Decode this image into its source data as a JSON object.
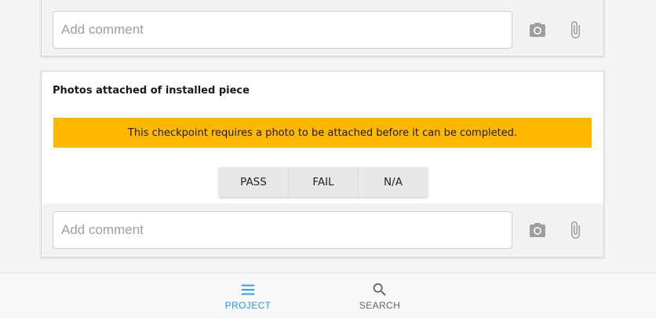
{
  "colors": {
    "warning_bg": "#ffb800",
    "accent": "#2196f3",
    "icon_gray": "#9e9e9e"
  },
  "top_card": {
    "comment_placeholder": "Add comment",
    "camera_icon": "camera-icon",
    "attach_icon": "paperclip-icon"
  },
  "checkpoint": {
    "title": "Photos attached of installed piece",
    "warning": "This checkpoint requires a photo to be attached before it can be completed.",
    "options": [
      "PASS",
      "FAIL",
      "N/A"
    ],
    "comment_placeholder": "Add comment",
    "camera_icon": "camera-icon",
    "attach_icon": "paperclip-icon"
  },
  "bottom_nav": {
    "items": [
      {
        "label": "PROJECT",
        "icon": "menu-icon",
        "active": true
      },
      {
        "label": "SEARCH",
        "icon": "search-icon",
        "active": false
      }
    ]
  }
}
